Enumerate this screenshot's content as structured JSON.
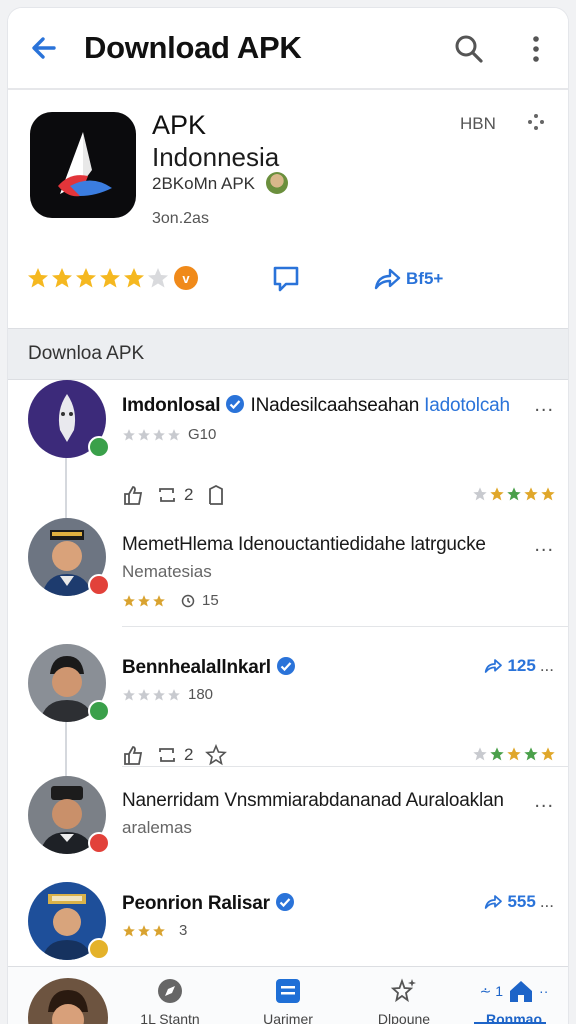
{
  "app_bar": {
    "title": "Download APK",
    "back_icon": "arrow-left-icon",
    "search_icon": "search-icon",
    "more_icon": "kebab-menu-icon",
    "accent": "#2a73d9"
  },
  "app": {
    "name_line1": "APK",
    "name_line2": "Indonnesia",
    "developer": "2BKoMn APK",
    "size": "3on.2as",
    "meta_code": "HBN",
    "rating_stars": 4.5,
    "badge": "v",
    "share_label": "Bf5+"
  },
  "section": {
    "title": "Downloa APK"
  },
  "posts": [
    {
      "name": "Imdonlosal",
      "verified": true,
      "body_inline": "INadesilcaahseahan",
      "tag": "Iadotolcah",
      "stars": 4,
      "count": "G10",
      "reply_count": "2",
      "more": "..."
    },
    {
      "body": "MemetHlema Idenouctantiedidahe latrgucke",
      "sub": "Nematesias",
      "stars": 3,
      "count": "15",
      "more": "..."
    },
    {
      "name": "Bennhealallnkarl",
      "verified": true,
      "stars": 4,
      "count": "180",
      "share_count": "125",
      "reply_count": "2",
      "more": "..."
    },
    {
      "body": "Nanerridam Vnsmmiarabdananad Auraloaklan",
      "sub": "aralemas",
      "more": "..."
    },
    {
      "name": "Peonrion Ralisar",
      "verified": true,
      "stars": 3,
      "count": "3",
      "share_count": "555",
      "more": "..."
    }
  ],
  "bottom_nav": [
    {
      "label": "1L Stantn",
      "icon": "compass-icon"
    },
    {
      "label": "Uarimer",
      "icon": "list-icon"
    },
    {
      "label": "Dlpoune",
      "icon": "sparkle-star-icon"
    },
    {
      "label": "Ronmao",
      "icon": "home-icon",
      "active": true,
      "prefix": "⩪ 1"
    }
  ]
}
